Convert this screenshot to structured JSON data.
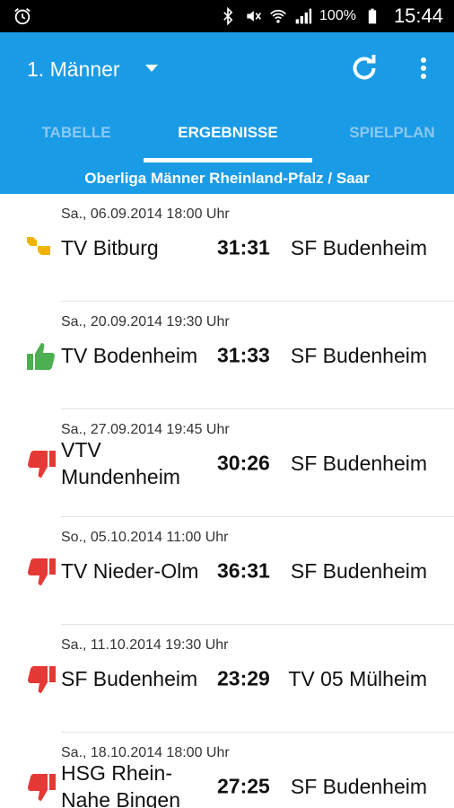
{
  "status_bar": {
    "battery": "100%",
    "time": "15:44",
    "icons": [
      "alarm-icon",
      "bluetooth-icon",
      "mute-icon",
      "wifi-icon",
      "signal-icon",
      "battery-icon"
    ]
  },
  "app_bar": {
    "title": "1. Männer"
  },
  "tabs": [
    {
      "label": "TABELLE"
    },
    {
      "label": "ERGEBNISSE",
      "active": true
    },
    {
      "label": "SPIELPLAN"
    }
  ],
  "league": "Oberliga Männer Rheinland-Pfalz / Saar",
  "colors": {
    "accent": "#1a9be6",
    "team_highlight": "#2e4f9e",
    "draw": "#f0b400",
    "win": "#4caf50",
    "loss": "#e53935"
  },
  "matches": [
    {
      "date": "Sa., 06.09.2014 18:00 Uhr",
      "home": "TV Bitburg",
      "score": "31:31",
      "away": "SF Budenheim",
      "result": "draw"
    },
    {
      "date": "Sa., 20.09.2014 19:30 Uhr",
      "home": "TV Bodenheim",
      "score": "31:33",
      "away": "SF Budenheim",
      "result": "win"
    },
    {
      "date": "Sa., 27.09.2014 19:45 Uhr",
      "home": "VTV Mundenheim",
      "score": "30:26",
      "away": "SF Budenheim",
      "result": "loss"
    },
    {
      "date": "So., 05.10.2014 11:00 Uhr",
      "home": "TV Nieder-Olm",
      "score": "36:31",
      "away": "SF Budenheim",
      "result": "loss"
    },
    {
      "date": "Sa., 11.10.2014 19:30 Uhr",
      "home": "SF Budenheim",
      "score": "23:29",
      "away": "TV 05 Mülheim",
      "result": "loss"
    },
    {
      "date": "Sa., 18.10.2014 18:00 Uhr",
      "home": "HSG Rhein-Nahe Bingen",
      "score": "27:25",
      "away": "SF Budenheim",
      "result": "loss"
    }
  ]
}
